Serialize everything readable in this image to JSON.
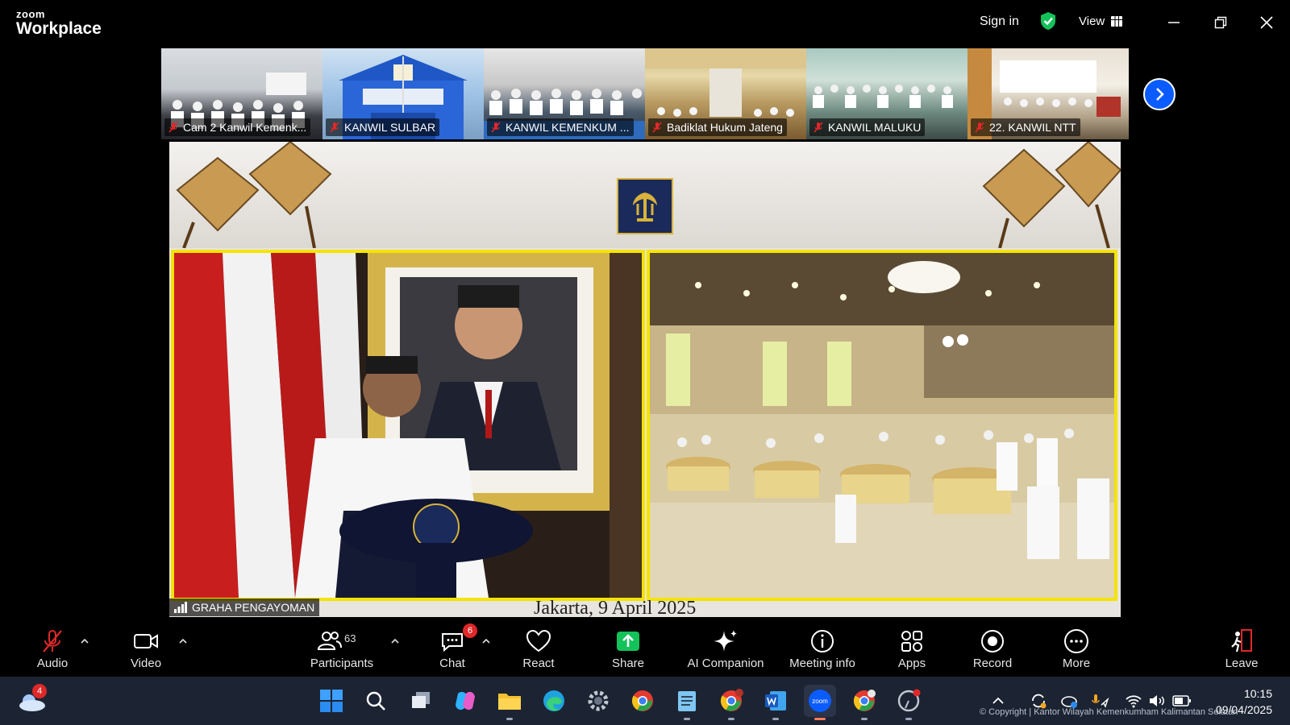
{
  "app": {
    "brand_top": "zoom",
    "brand_bottom": "Workplace",
    "sign_in": "Sign in",
    "view": "View"
  },
  "thumbnails": [
    {
      "name": "Cam 2 Kanwil Kemenk..."
    },
    {
      "name": "KANWIL SULBAR"
    },
    {
      "name": "KANWIL KEMENKUM ..."
    },
    {
      "name": "Badiklat Hukum Jateng"
    },
    {
      "name": "KANWIL MALUKU"
    },
    {
      "name": "22. KANWIL NTT"
    }
  ],
  "main_video": {
    "caption": "Jakarta, 9 April 2025",
    "speaker": "GRAHA PENGAYOMAN"
  },
  "toolbar": {
    "audio": "Audio",
    "video": "Video",
    "participants": "Participants",
    "participants_count": "63",
    "chat": "Chat",
    "chat_badge": "6",
    "react": "React",
    "share": "Share",
    "ai_companion": "AI Companion",
    "meeting_info": "Meeting info",
    "apps": "Apps",
    "record": "Record",
    "more": "More",
    "leave": "Leave"
  },
  "taskbar": {
    "weather_badge": "4",
    "time": "10:15",
    "date": "09/04/2025",
    "copyright": "© Copyright | Kantor Wilayah Kemenkumham Kalimantan Selatan"
  },
  "colors": {
    "accent_blue": "#0b5cff",
    "share_green": "#14c25a",
    "mute_red": "#e02828",
    "frame_yellow": "#f5e400"
  }
}
